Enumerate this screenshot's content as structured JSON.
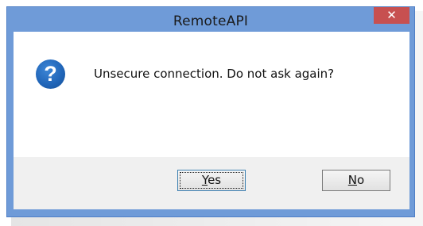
{
  "window": {
    "title": "RemoteAPI",
    "close_icon": "close-icon",
    "close_glyph": "✕"
  },
  "dialog": {
    "icon": "question-icon",
    "icon_glyph": "?",
    "message": "Unsecure connection. Do not ask again?"
  },
  "buttons": {
    "yes": {
      "mnemonic": "Y",
      "rest": "es"
    },
    "no": {
      "mnemonic": "N",
      "rest": "o"
    }
  },
  "colors": {
    "title_bar": "#6f9bd8",
    "close_button": "#c75050",
    "icon_blue": "#1f64b7",
    "footer": "#f0f0f0"
  }
}
